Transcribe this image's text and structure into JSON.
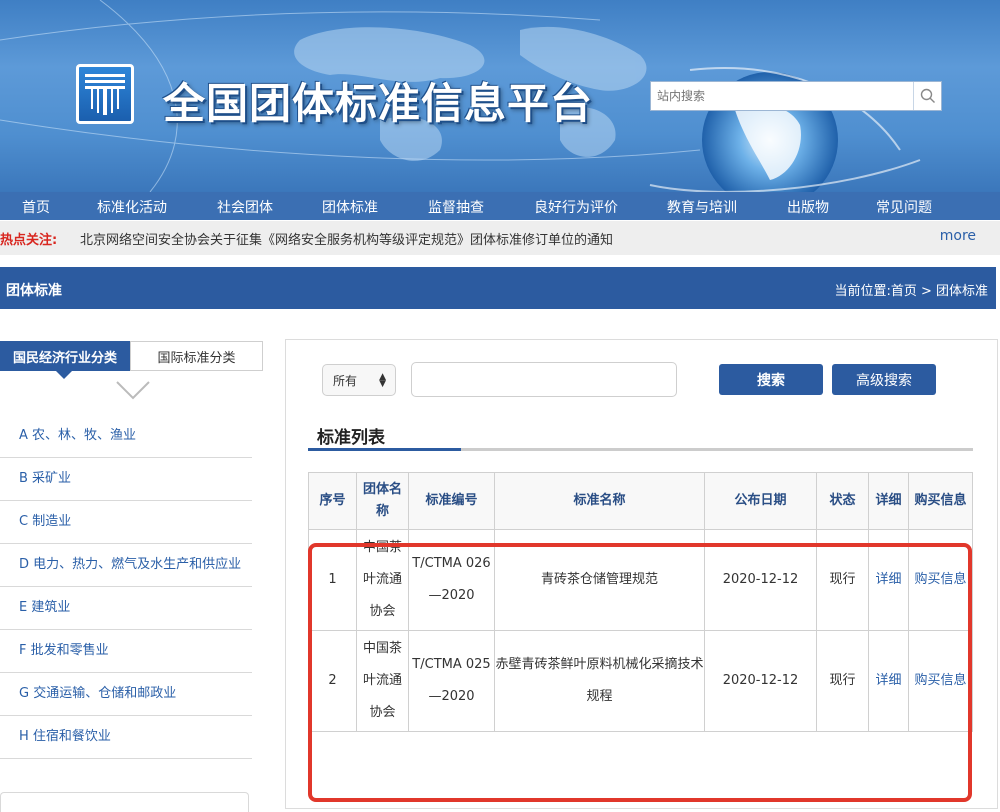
{
  "header": {
    "site_title": "全国团体标准信息平台",
    "search_placeholder": "站内搜索"
  },
  "nav": {
    "items": [
      "首页",
      "标准化活动",
      "社会团体",
      "团体标准",
      "监督抽查",
      "良好行为评价",
      "教育与培训",
      "出版物",
      "常见问题"
    ]
  },
  "hot": {
    "label": "热点关注:",
    "text": "北京网络空间安全协会关于征集《网络安全服务机构等级评定规范》团体标准修订单位的通知",
    "more": "more"
  },
  "section": {
    "title": "团体标准",
    "breadcrumb": "当前位置:首页 > 团体标准"
  },
  "left": {
    "tabs": [
      "国民经济行业分类",
      "国际标准分类"
    ],
    "categories": [
      "A 农、林、牧、渔业",
      "B 采矿业",
      "C 制造业",
      "D 电力、热力、燃气及水生产和供应业",
      "E 建筑业",
      "F 批发和零售业",
      "G 交通运输、仓储和邮政业",
      "H 住宿和餐饮业"
    ]
  },
  "search": {
    "select_value": "所有",
    "keyword_value": "",
    "search_button": "搜索",
    "advanced_button": "高级搜索"
  },
  "list": {
    "title": "标准列表",
    "columns": [
      "序号",
      "团体名称",
      "标准编号",
      "标准名称",
      "公布日期",
      "状态",
      "详细",
      "购买信息"
    ],
    "rows": [
      {
        "index": "1",
        "org": "中国茶叶流通协会",
        "code": "T/CTMA 026—2020",
        "name": "青砖茶仓储管理规范",
        "date": "2020-12-12",
        "status": "现行",
        "detail": "详细",
        "buy": "购买信息"
      },
      {
        "index": "2",
        "org": "中国茶叶流通协会",
        "code": "T/CTMA 025—2020",
        "name": "赤壁青砖茶鲜叶原料机械化采摘技术规程",
        "date": "2020-12-12",
        "status": "现行",
        "detail": "详细",
        "buy": "购买信息"
      }
    ]
  },
  "colors": {
    "nav_blue": "#3b6fb3",
    "section_blue": "#2c5ba0",
    "link_blue": "#2a5fa8",
    "hot_red": "#d8261f",
    "highlight_red": "#e1372b"
  }
}
